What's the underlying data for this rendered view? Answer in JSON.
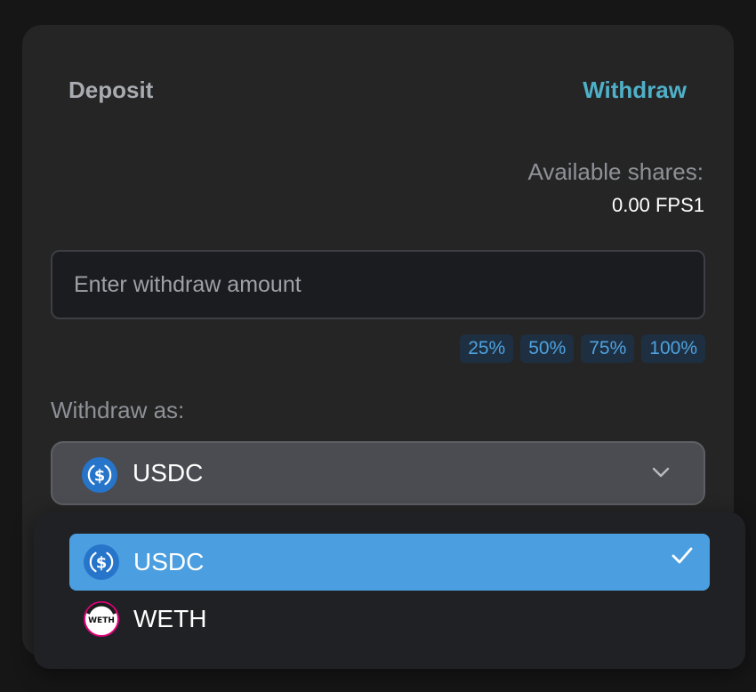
{
  "tabs": {
    "deposit": "Deposit",
    "withdraw": "Withdraw"
  },
  "available": {
    "label": "Available shares:",
    "value": "0.00 FPS1"
  },
  "amount_input": {
    "placeholder": "Enter withdraw amount",
    "value": ""
  },
  "percent_buttons": [
    "25%",
    "50%",
    "75%",
    "100%"
  ],
  "withdraw_as": {
    "label": "Withdraw as:",
    "selected": "USDC",
    "selected_icon": "usdc-icon",
    "options": [
      {
        "label": "USDC",
        "icon": "usdc-icon",
        "selected": true
      },
      {
        "label": "WETH",
        "icon": "weth-icon",
        "selected": false
      }
    ]
  },
  "colors": {
    "accent_tab": "#4fb0c8",
    "percent_text": "#4ea2de",
    "selected_option": "#4b9fe0",
    "usdc": "#2775ca",
    "weth_ring": "#e3007a"
  }
}
